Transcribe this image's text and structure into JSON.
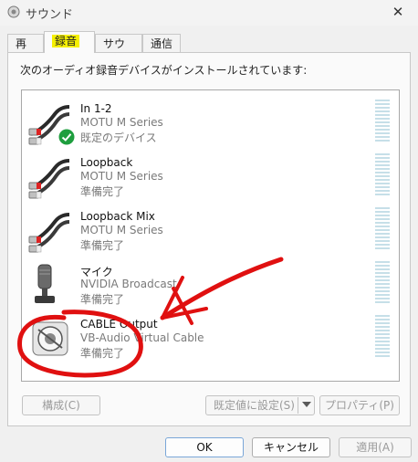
{
  "window": {
    "title": "サウンド",
    "close_glyph": "✕"
  },
  "tabs": [
    {
      "label": "再生"
    },
    {
      "label": "録音",
      "highlight": "#f5f000"
    },
    {
      "label": "サウンド"
    },
    {
      "label": "通信"
    }
  ],
  "instructions": "次のオーディオ録音デバイスがインストールされています:",
  "devices": [
    {
      "name": "In 1-2",
      "description": "MOTU M Series",
      "status": "既定のデバイス",
      "icon": "rca-cable-icon",
      "default_badge": "green-check-icon"
    },
    {
      "name": "Loopback",
      "description": "MOTU M Series",
      "status": "準備完了",
      "icon": "rca-cable-icon"
    },
    {
      "name": "Loopback Mix",
      "description": "MOTU M Series",
      "status": "準備完了",
      "icon": "rca-cable-icon"
    },
    {
      "name": "マイク",
      "description": "NVIDIA Broadcast",
      "status": "準備完了",
      "icon": "microphone-icon"
    },
    {
      "name": "CABLE Output",
      "description": "VB-Audio Virtual Cable",
      "status": "準備完了",
      "icon": "vb-cable-icon"
    }
  ],
  "buttons": {
    "configure": "構成(C)",
    "set_default": "既定値に設定(S)",
    "properties": "プロパティ(P)",
    "ok": "OK",
    "cancel": "キャンセル",
    "apply": "適用(A)"
  },
  "colors": {
    "annotation_red": "#e01010",
    "meter_blue": "#c6dfe8",
    "check_green": "#1e9e3e"
  }
}
